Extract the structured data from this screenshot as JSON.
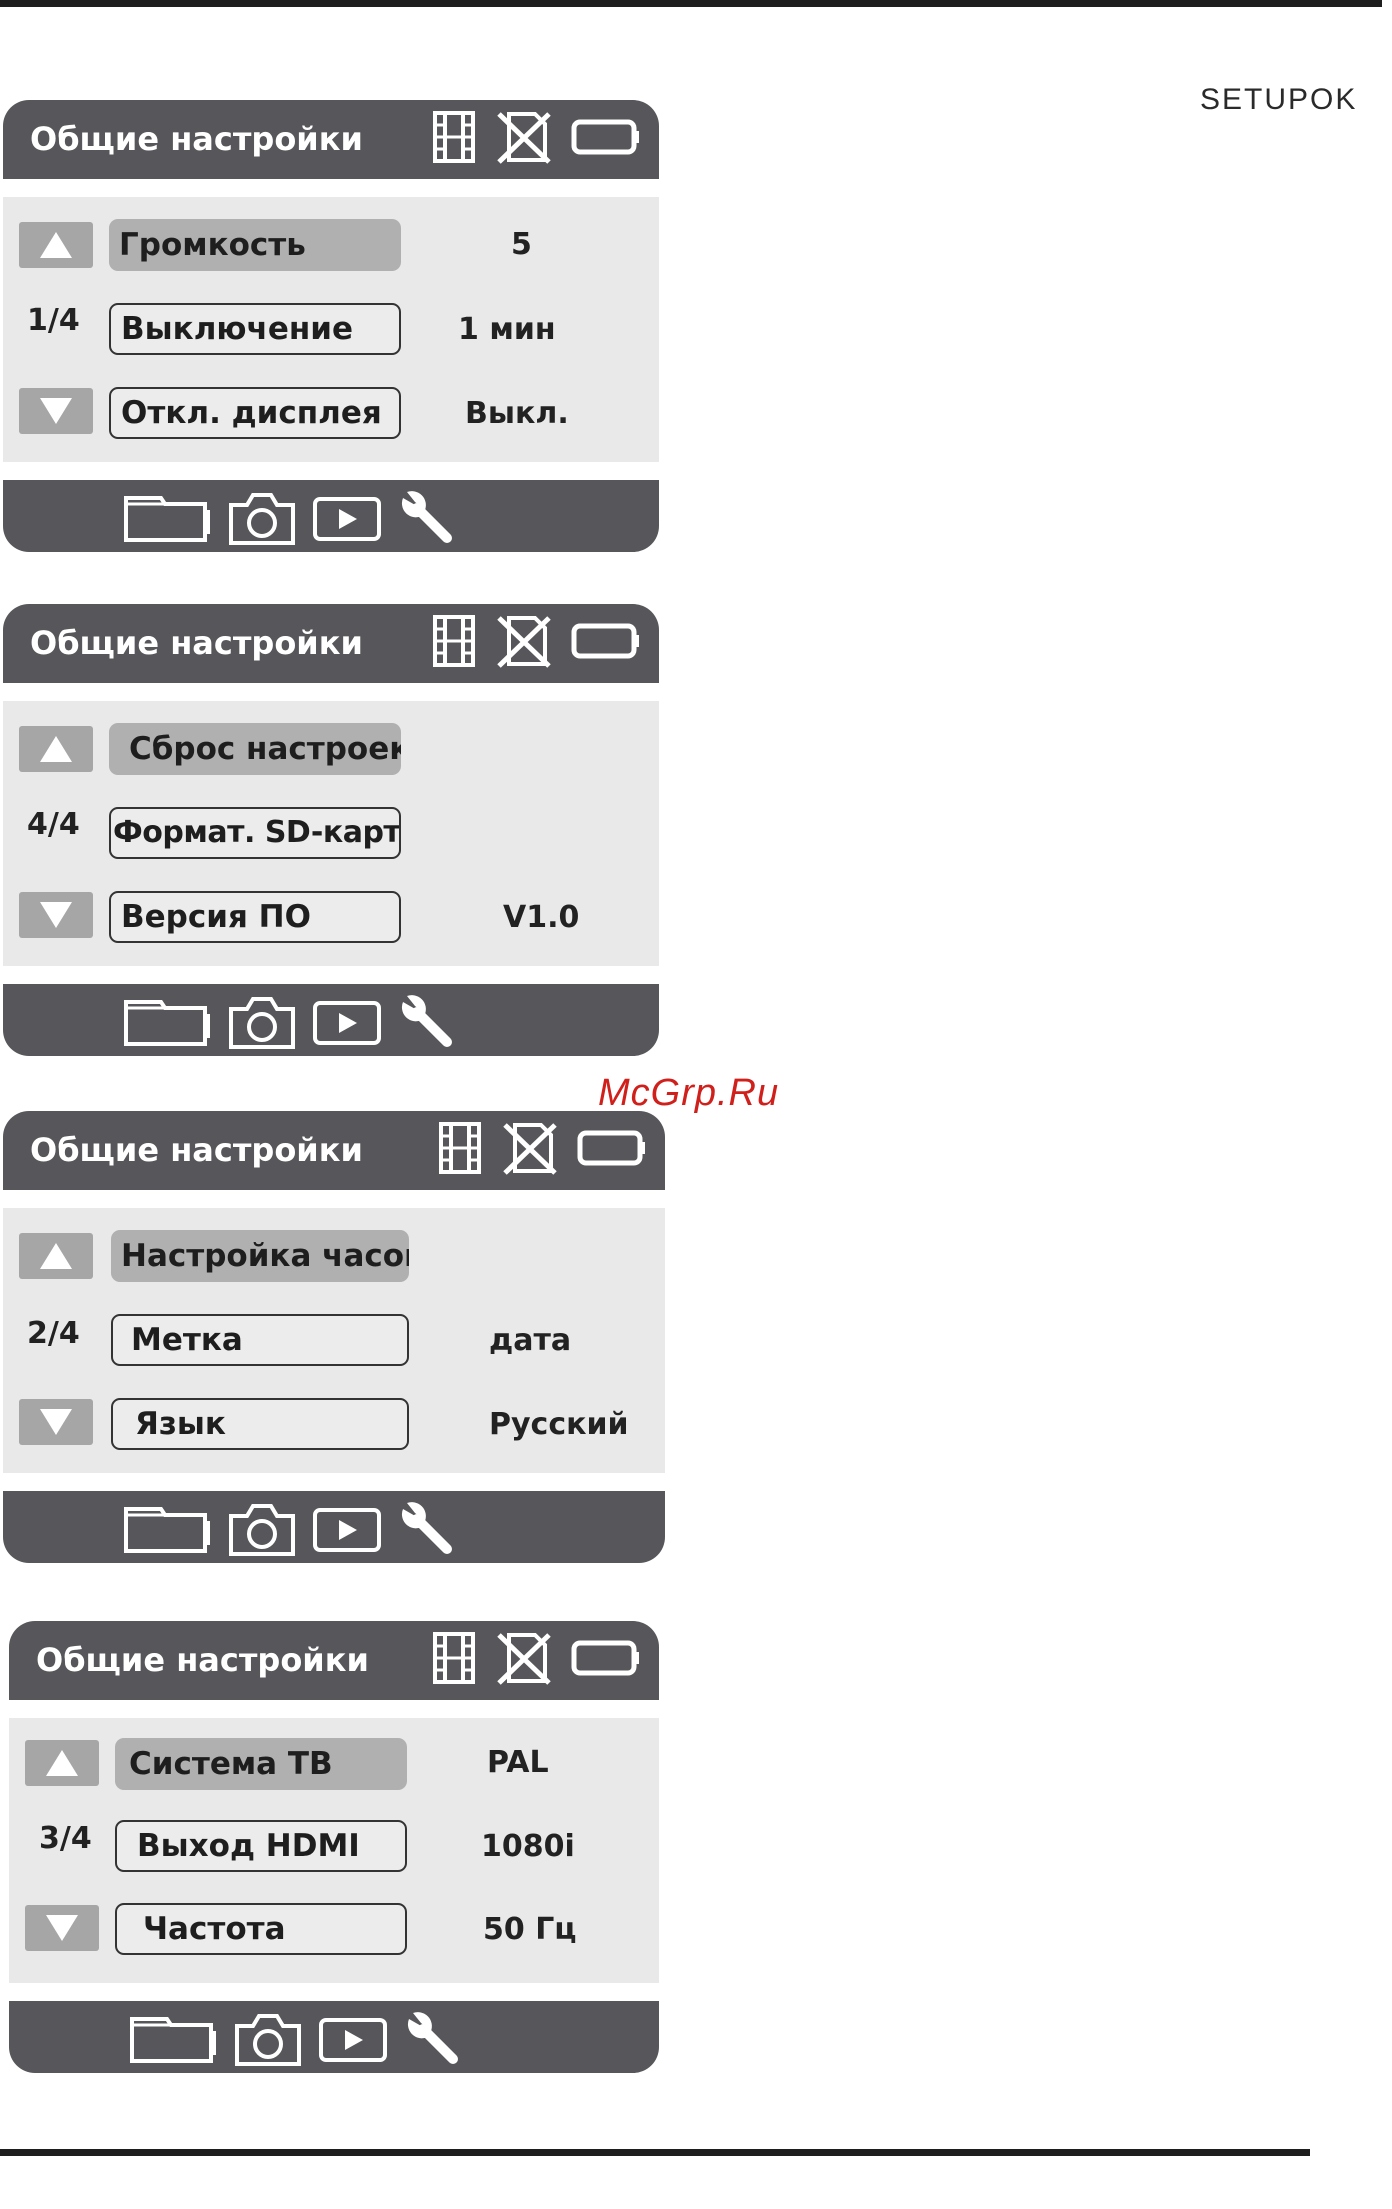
{
  "brand": "SETUPOK",
  "watermark": "McGrp.Ru",
  "icons": {
    "header": [
      "film-strip-icon",
      "memory-card-off-icon",
      "battery-icon"
    ],
    "footer": [
      "video-mode-icon",
      "camera-icon",
      "playback-icon",
      "wrench-icon"
    ],
    "scroll": [
      "arrow-up-icon",
      "arrow-down-icon"
    ]
  },
  "colors": {
    "bar": "#57575b",
    "body": "#e9e9e9",
    "highlight": "#b0b0b0",
    "watermark": "#d0201c"
  },
  "panels": [
    {
      "title": "Общие настройки",
      "page": "1/4",
      "items": [
        {
          "label": "Громкость",
          "value": "5",
          "selected": true
        },
        {
          "label": "Выключение",
          "value": "1 мин",
          "selected": false
        },
        {
          "label": "Откл. дисплея",
          "value": "Выкл.",
          "selected": false
        }
      ]
    },
    {
      "title": "Общие настройки",
      "page": "4/4",
      "items": [
        {
          "label": "Сброс настроек",
          "value": "",
          "selected": true
        },
        {
          "label": "Формат. SD-карту",
          "value": "",
          "selected": false
        },
        {
          "label": "Версия ПО",
          "value": "V1.0",
          "selected": false
        }
      ]
    },
    {
      "title": "Общие настройки",
      "page": "2/4",
      "items": [
        {
          "label": "Настройка часов",
          "value": "",
          "selected": true
        },
        {
          "label": "Метка",
          "value": "дата",
          "selected": false
        },
        {
          "label": "Язык",
          "value": "Русский",
          "selected": false
        }
      ]
    },
    {
      "title": "Общие настройки",
      "page": "3/4",
      "items": [
        {
          "label": "Система ТВ",
          "value": "PAL",
          "selected": true
        },
        {
          "label": "Выход HDMI",
          "value": "1080i",
          "selected": false
        },
        {
          "label": "Частота",
          "value": "50 Гц",
          "selected": false
        }
      ]
    }
  ]
}
